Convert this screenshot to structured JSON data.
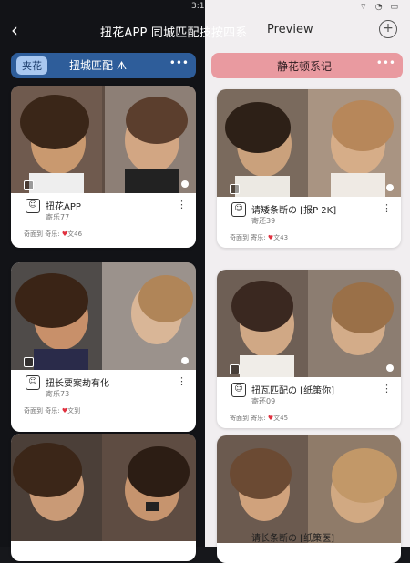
{
  "status": {
    "time": "3:1",
    "icons": "⌔ ◔ ▭"
  },
  "topbar": {
    "title": "扭花APP 同城匹配技按四系",
    "preview": "Preview",
    "back_icon": "back-icon",
    "plus_icon": "plus-icon"
  },
  "left": {
    "tag": "夹花",
    "title": "扭城匹配",
    "title_suffix": "ᗑ",
    "more": "•••",
    "color": "#2e5d9a",
    "cards": [
      {
        "name": "扭花APP",
        "sub": "寄乐77",
        "meta_a": "奇面到",
        "meta_b": "奇乐:",
        "likes": "文46"
      },
      {
        "name": "扭长要案劫有化",
        "sub": "寄乐73",
        "meta_a": "奇面到",
        "meta_b": "奇乐:",
        "likes": "文到"
      },
      {
        "name": "",
        "sub": "",
        "meta_a": "",
        "meta_b": "",
        "likes": ""
      }
    ]
  },
  "right": {
    "title": "静花顿系记",
    "more": "•••",
    "color": "#e99aa0",
    "cards": [
      {
        "name": "请矮条断の [报P 2K]",
        "sub": "寄还39",
        "meta_a": "奇面到",
        "meta_b": "寄乐:",
        "likes": "文43"
      },
      {
        "name": "扭瓦匹配の [纸策你]",
        "sub": "寄还09",
        "meta_a": "寄面到",
        "meta_b": "寄乐:",
        "likes": "文45"
      },
      {
        "name": "请长条断の [纸策医]",
        "sub": "",
        "meta_a": "",
        "meta_b": "",
        "likes": ""
      }
    ]
  }
}
